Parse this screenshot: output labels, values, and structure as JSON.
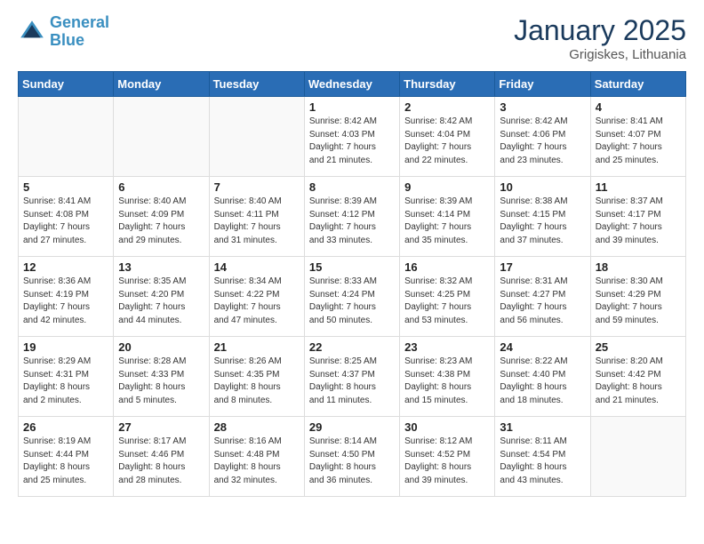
{
  "header": {
    "logo_line1": "General",
    "logo_line2": "Blue",
    "month_title": "January 2025",
    "location": "Grigiskes, Lithuania"
  },
  "weekdays": [
    "Sunday",
    "Monday",
    "Tuesday",
    "Wednesday",
    "Thursday",
    "Friday",
    "Saturday"
  ],
  "weeks": [
    [
      {
        "day": "",
        "info": ""
      },
      {
        "day": "",
        "info": ""
      },
      {
        "day": "",
        "info": ""
      },
      {
        "day": "1",
        "info": "Sunrise: 8:42 AM\nSunset: 4:03 PM\nDaylight: 7 hours\nand 21 minutes."
      },
      {
        "day": "2",
        "info": "Sunrise: 8:42 AM\nSunset: 4:04 PM\nDaylight: 7 hours\nand 22 minutes."
      },
      {
        "day": "3",
        "info": "Sunrise: 8:42 AM\nSunset: 4:06 PM\nDaylight: 7 hours\nand 23 minutes."
      },
      {
        "day": "4",
        "info": "Sunrise: 8:41 AM\nSunset: 4:07 PM\nDaylight: 7 hours\nand 25 minutes."
      }
    ],
    [
      {
        "day": "5",
        "info": "Sunrise: 8:41 AM\nSunset: 4:08 PM\nDaylight: 7 hours\nand 27 minutes."
      },
      {
        "day": "6",
        "info": "Sunrise: 8:40 AM\nSunset: 4:09 PM\nDaylight: 7 hours\nand 29 minutes."
      },
      {
        "day": "7",
        "info": "Sunrise: 8:40 AM\nSunset: 4:11 PM\nDaylight: 7 hours\nand 31 minutes."
      },
      {
        "day": "8",
        "info": "Sunrise: 8:39 AM\nSunset: 4:12 PM\nDaylight: 7 hours\nand 33 minutes."
      },
      {
        "day": "9",
        "info": "Sunrise: 8:39 AM\nSunset: 4:14 PM\nDaylight: 7 hours\nand 35 minutes."
      },
      {
        "day": "10",
        "info": "Sunrise: 8:38 AM\nSunset: 4:15 PM\nDaylight: 7 hours\nand 37 minutes."
      },
      {
        "day": "11",
        "info": "Sunrise: 8:37 AM\nSunset: 4:17 PM\nDaylight: 7 hours\nand 39 minutes."
      }
    ],
    [
      {
        "day": "12",
        "info": "Sunrise: 8:36 AM\nSunset: 4:19 PM\nDaylight: 7 hours\nand 42 minutes."
      },
      {
        "day": "13",
        "info": "Sunrise: 8:35 AM\nSunset: 4:20 PM\nDaylight: 7 hours\nand 44 minutes."
      },
      {
        "day": "14",
        "info": "Sunrise: 8:34 AM\nSunset: 4:22 PM\nDaylight: 7 hours\nand 47 minutes."
      },
      {
        "day": "15",
        "info": "Sunrise: 8:33 AM\nSunset: 4:24 PM\nDaylight: 7 hours\nand 50 minutes."
      },
      {
        "day": "16",
        "info": "Sunrise: 8:32 AM\nSunset: 4:25 PM\nDaylight: 7 hours\nand 53 minutes."
      },
      {
        "day": "17",
        "info": "Sunrise: 8:31 AM\nSunset: 4:27 PM\nDaylight: 7 hours\nand 56 minutes."
      },
      {
        "day": "18",
        "info": "Sunrise: 8:30 AM\nSunset: 4:29 PM\nDaylight: 7 hours\nand 59 minutes."
      }
    ],
    [
      {
        "day": "19",
        "info": "Sunrise: 8:29 AM\nSunset: 4:31 PM\nDaylight: 8 hours\nand 2 minutes."
      },
      {
        "day": "20",
        "info": "Sunrise: 8:28 AM\nSunset: 4:33 PM\nDaylight: 8 hours\nand 5 minutes."
      },
      {
        "day": "21",
        "info": "Sunrise: 8:26 AM\nSunset: 4:35 PM\nDaylight: 8 hours\nand 8 minutes."
      },
      {
        "day": "22",
        "info": "Sunrise: 8:25 AM\nSunset: 4:37 PM\nDaylight: 8 hours\nand 11 minutes."
      },
      {
        "day": "23",
        "info": "Sunrise: 8:23 AM\nSunset: 4:38 PM\nDaylight: 8 hours\nand 15 minutes."
      },
      {
        "day": "24",
        "info": "Sunrise: 8:22 AM\nSunset: 4:40 PM\nDaylight: 8 hours\nand 18 minutes."
      },
      {
        "day": "25",
        "info": "Sunrise: 8:20 AM\nSunset: 4:42 PM\nDaylight: 8 hours\nand 21 minutes."
      }
    ],
    [
      {
        "day": "26",
        "info": "Sunrise: 8:19 AM\nSunset: 4:44 PM\nDaylight: 8 hours\nand 25 minutes."
      },
      {
        "day": "27",
        "info": "Sunrise: 8:17 AM\nSunset: 4:46 PM\nDaylight: 8 hours\nand 28 minutes."
      },
      {
        "day": "28",
        "info": "Sunrise: 8:16 AM\nSunset: 4:48 PM\nDaylight: 8 hours\nand 32 minutes."
      },
      {
        "day": "29",
        "info": "Sunrise: 8:14 AM\nSunset: 4:50 PM\nDaylight: 8 hours\nand 36 minutes."
      },
      {
        "day": "30",
        "info": "Sunrise: 8:12 AM\nSunset: 4:52 PM\nDaylight: 8 hours\nand 39 minutes."
      },
      {
        "day": "31",
        "info": "Sunrise: 8:11 AM\nSunset: 4:54 PM\nDaylight: 8 hours\nand 43 minutes."
      },
      {
        "day": "",
        "info": ""
      }
    ]
  ]
}
